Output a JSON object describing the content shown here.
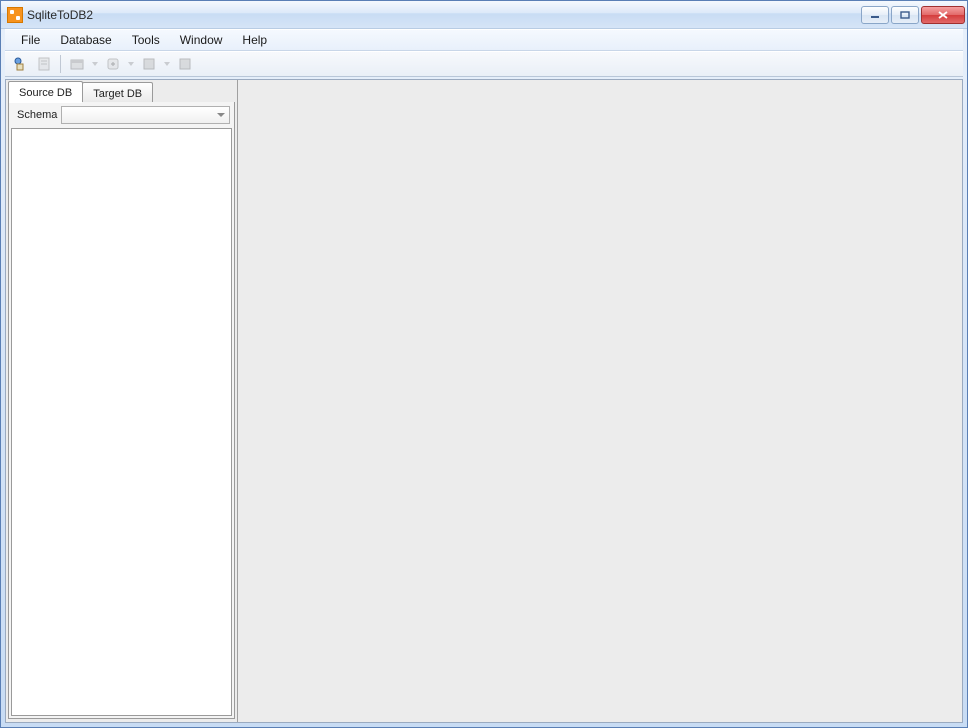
{
  "window": {
    "title": "SqliteToDB2"
  },
  "menu": {
    "items": [
      "File",
      "Database",
      "Tools",
      "Window",
      "Help"
    ]
  },
  "toolbar": {
    "icons": [
      "wizard-icon",
      "settings-icon",
      "import-icon",
      "export-icon",
      "run-icon",
      "stop-icon"
    ]
  },
  "left_panel": {
    "tabs": [
      {
        "label": "Source DB",
        "active": true
      },
      {
        "label": "Target DB",
        "active": false
      }
    ],
    "schema_label": "Schema",
    "schema_value": ""
  }
}
